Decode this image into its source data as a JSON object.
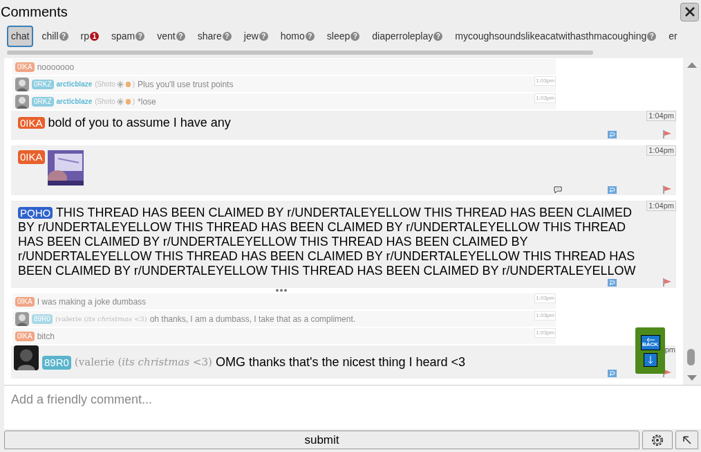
{
  "window": {
    "title": "Comments"
  },
  "tabs": [
    {
      "label": "chat",
      "selected": true
    },
    {
      "label": "chill",
      "selected": false,
      "badge": {
        "kind": "help",
        "text": "?"
      }
    },
    {
      "label": "rp",
      "selected": false,
      "badge": {
        "kind": "unread",
        "text": "1"
      }
    },
    {
      "label": "spam",
      "selected": false,
      "badge": {
        "kind": "help",
        "text": "?"
      }
    },
    {
      "label": "vent",
      "selected": false,
      "badge": {
        "kind": "help",
        "text": "?"
      }
    },
    {
      "label": "share",
      "selected": false,
      "badge": {
        "kind": "help",
        "text": "?"
      }
    },
    {
      "label": "jew",
      "selected": false,
      "badge": {
        "kind": "help",
        "text": "?"
      }
    },
    {
      "label": "homo",
      "selected": false,
      "badge": {
        "kind": "help",
        "text": "?"
      }
    },
    {
      "label": "sleep",
      "selected": false,
      "badge": {
        "kind": "help",
        "text": "?"
      }
    },
    {
      "label": "diaperroleplay",
      "selected": false,
      "badge": {
        "kind": "help",
        "text": "?"
      }
    },
    {
      "label": "mycoughsoundslikeacatwithasthmacoughing",
      "selected": false,
      "badge": {
        "kind": "help",
        "text": "?"
      }
    },
    {
      "label": "er"
    }
  ],
  "messages": [
    {
      "kind": "compact",
      "tag": "0IKA",
      "color": "#f0a585",
      "text": "nooooooo"
    },
    {
      "kind": "compact",
      "avatar": true,
      "tag": "0RKZ",
      "color": "#8fcde0",
      "username": "arcticblaze",
      "flair_open": "(Shoto",
      "flair_close": ")",
      "text": "Plus you'll use trust points",
      "time": "1:03pm"
    },
    {
      "kind": "compact",
      "avatar": true,
      "tag": "0RKZ",
      "color": "#8fcde0",
      "username": "arcticblaze",
      "flair_open": "(Shoto",
      "flair_close": ")",
      "text": "*lose",
      "time": "1:03pm"
    },
    {
      "kind": "full",
      "tag": "0IKA",
      "color": "#e8602c",
      "text": "bold of you to assume I have any",
      "time": "1:04pm"
    },
    {
      "kind": "full",
      "tag": "0IKA",
      "color": "#e8602c",
      "image": true,
      "comments": true,
      "time": "1:04pm"
    },
    {
      "kind": "full",
      "tag": "PQHO",
      "color": "#2f62cc",
      "text": "THIS THREAD HAS BEEN CLAIMED BY r/UNDERTALEYELLOW THIS THREAD HAS BEEN CLAIMED BY r/UNDERTALEYELLOW THIS THREAD HAS BEEN CLAIMED BY r/UNDERTALEYELLOW THIS THREAD HAS BEEN CLAIMED BY r/UNDERTALEYELLOW THIS THREAD HAS BEEN CLAIMED BY r/UNDERTALEYELLOW THIS THREAD HAS BEEN CLAIMED BY r/UNDERTALEYELLOW THIS THREAD HAS BEEN CLAIMED BY r/UNDERTALEYELLOW THIS THREAD HAS BEEN CLAIMED BY r/UNDERTALEYELLOW",
      "time": "1:04pm",
      "more": true
    },
    {
      "kind": "compact",
      "tag": "0IKA",
      "color": "#f0a585",
      "text": "I was making a joke dumbass",
      "time": "1:03pm"
    },
    {
      "kind": "compact",
      "avatar": true,
      "tag": "89R0",
      "color": "#a8d8e6",
      "flair": "(valerie (*its christmas* <3)",
      "text": "oh thanks, I am a dumbass, I take that as a compliment.",
      "time": "1:03pm"
    },
    {
      "kind": "compact",
      "tag": "0IKA",
      "color": "#f0a585",
      "text": "bitch",
      "time": "1:03pm"
    },
    {
      "kind": "full",
      "avatar": true,
      "tag": "89R0",
      "color": "#5ab4cc",
      "flair": "(valerie (*its christmas* <3)",
      "text": "OMG thanks that's the nicest thing I heard <3",
      "time": "pm"
    }
  ],
  "composer": {
    "placeholder": "Add a friendly comment..."
  },
  "submit": "submit",
  "jump": {
    "back": "BACK"
  }
}
